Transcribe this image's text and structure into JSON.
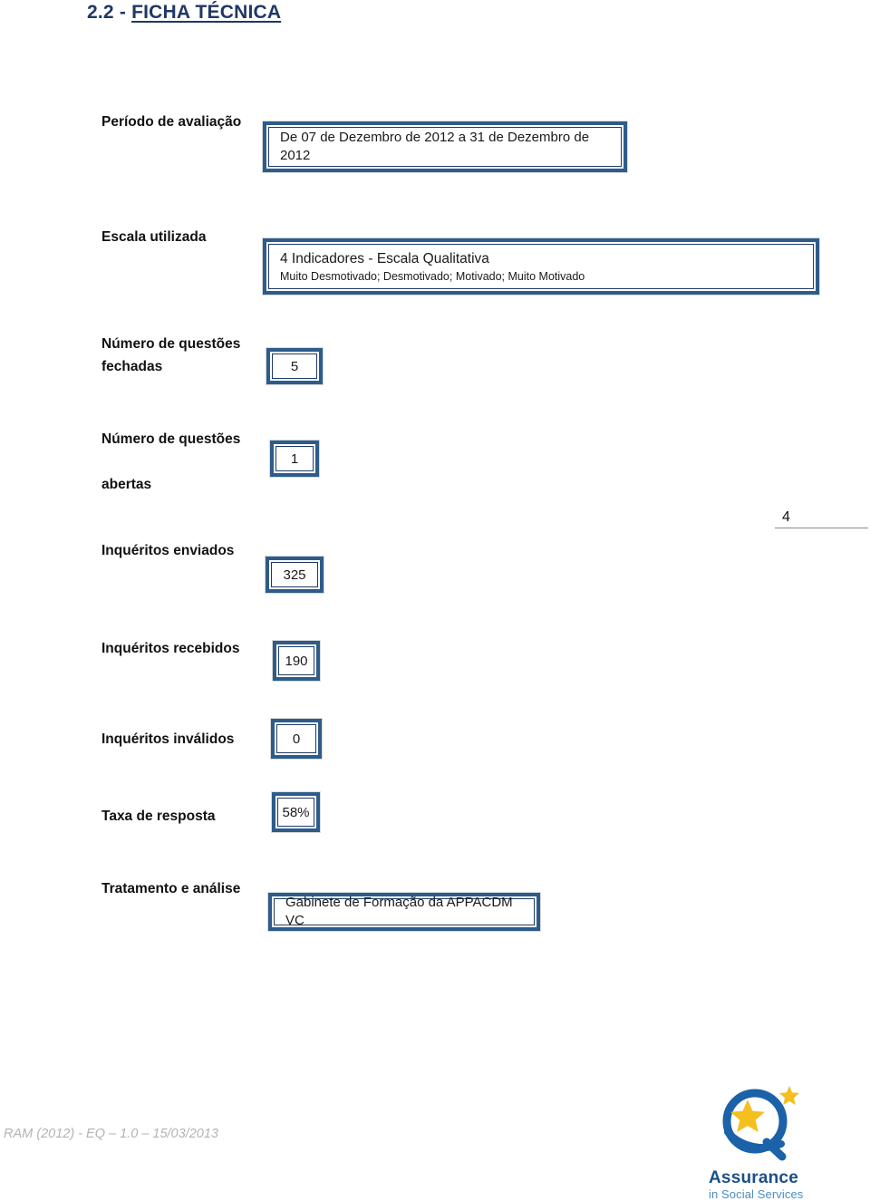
{
  "document": {
    "section_number": "2.2 - ",
    "section_title": "FICHA TÉCNICA"
  },
  "fields": [
    {
      "label": "Período de avaliação",
      "value": "De 07 de Dezembro de 2012 a 31 de Dezembro de 2012"
    },
    {
      "label": "Escala utilizada",
      "value_main": "4 Indicadores - Escala Qualitativa",
      "value_sub": "Muito Desmotivado; Desmotivado; Motivado; Muito Motivado"
    },
    {
      "label": "Número de questões\nfechadas",
      "value": "5"
    },
    {
      "label": "Número de questões\n\nabertas",
      "value": "1"
    },
    {
      "label": "Inquéritos enviados",
      "value": "325"
    },
    {
      "label": "Inquéritos recebidos",
      "value": "190"
    },
    {
      "label": "Inquéritos inválidos",
      "value": "0"
    },
    {
      "label": "Taxa de resposta",
      "value": "58%"
    },
    {
      "label": "Tratamento e análise",
      "value": "Gabinete de Formação da APPACDM VC"
    }
  ],
  "page_marker": {
    "number": "4"
  },
  "footer": {
    "reference": "RAM (2012) - EQ – 1.0 – 15/03/2013"
  },
  "logo": {
    "name": "Assurance",
    "tagline": "in Social Services",
    "ring_color": "#1b62a8",
    "star_color": "#f5bf1e"
  }
}
